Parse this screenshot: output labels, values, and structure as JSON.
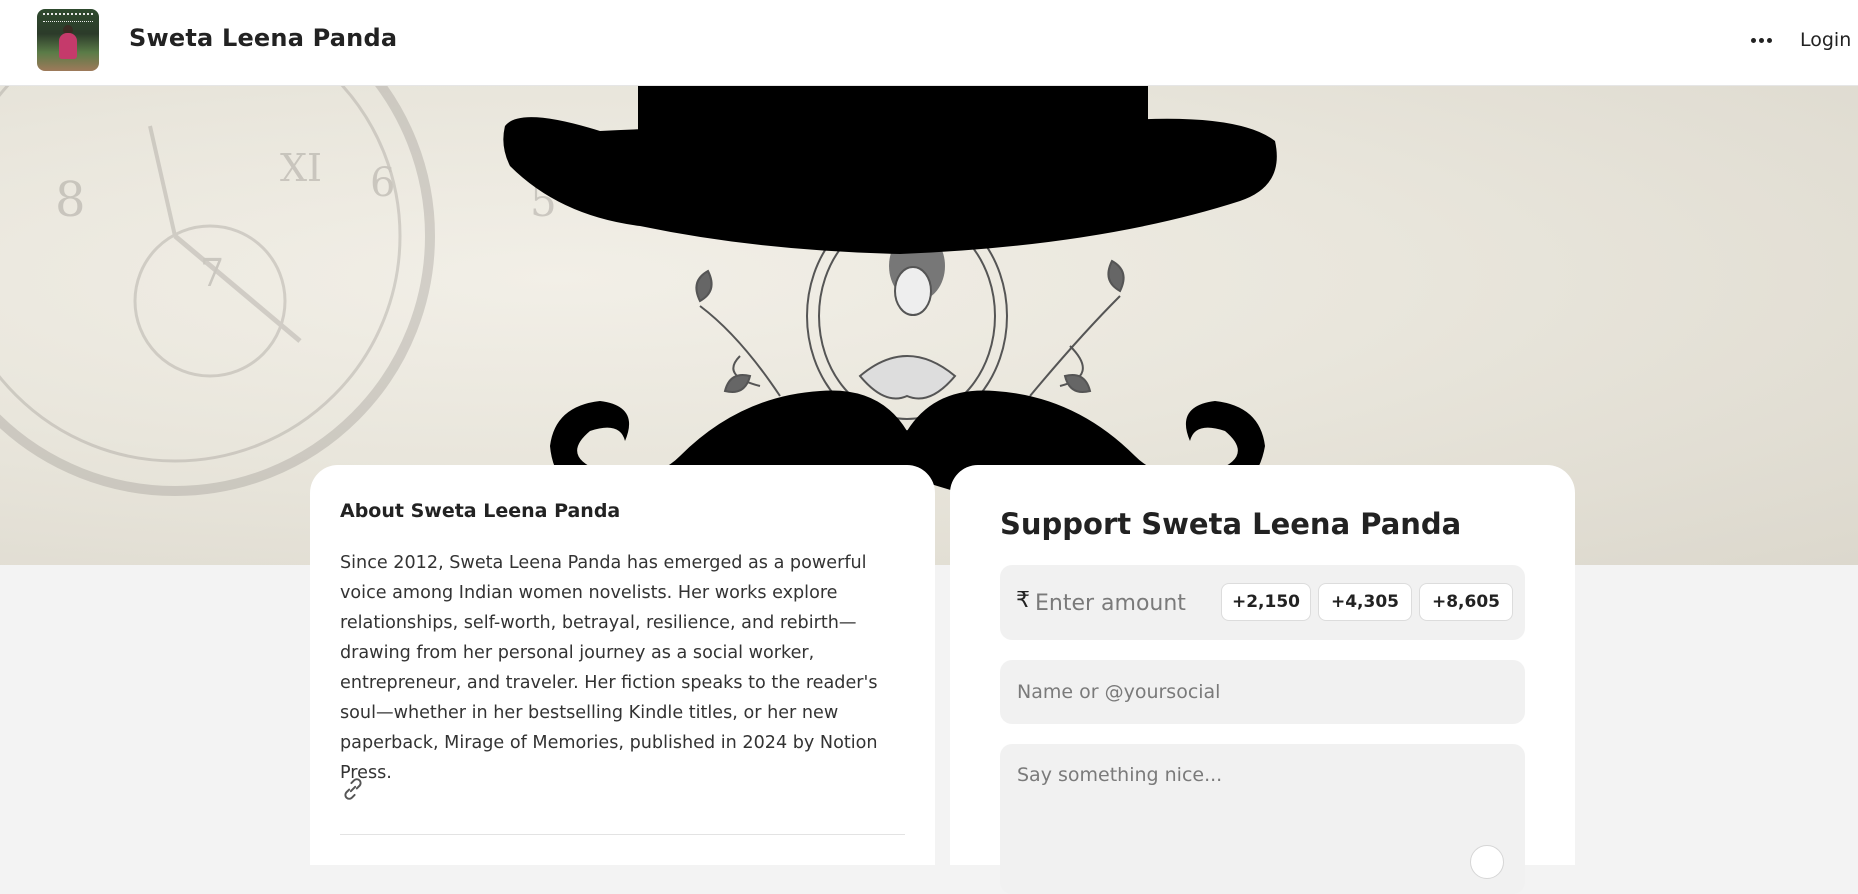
{
  "header": {
    "site_title": "Sweta Leena Panda",
    "login_label": "Login"
  },
  "icons": {
    "more": "more-horizontal-icon",
    "link": "link-icon",
    "emoji": "emoji-icon"
  },
  "about": {
    "title": "About Sweta Leena Panda",
    "body": "Since 2012, Sweta Leena Panda has emerged as a powerful voice among Indian women novelists. Her works explore relationships, self-worth, betrayal, resilience, and rebirth—drawing from her personal journey as a social worker, entrepreneur, and traveler. Her fiction speaks to the reader's soul—whether in her bestselling Kindle titles, or her new paperback, Mirage of Memories, published in 2024 by Notion Press."
  },
  "support": {
    "title": "Support Sweta Leena Panda",
    "currency_symbol": "₹",
    "amount_placeholder": "Enter amount",
    "quick_amounts": [
      "+2,150",
      "+4,305",
      "+8,605"
    ],
    "name_placeholder": "Name or @yoursocial",
    "message_placeholder": "Say something nice..."
  },
  "colors": {
    "page_bg": "#f3f3f3",
    "card_bg": "#ffffff",
    "input_bg": "#f1f1f1",
    "text": "#222222"
  }
}
